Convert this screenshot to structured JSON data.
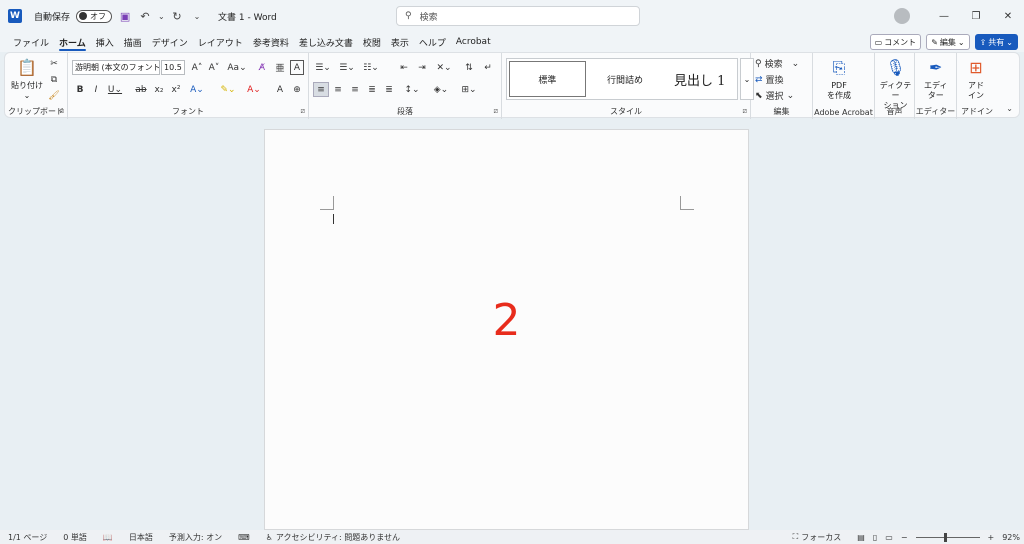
{
  "titlebar": {
    "autosave_label": "自動保存",
    "autosave_state": "オフ",
    "doc_title": "文書 1  -  Word",
    "search_placeholder": "検索"
  },
  "menu": {
    "tabs": [
      "ファイル",
      "ホーム",
      "挿入",
      "描画",
      "デザイン",
      "レイアウト",
      "参考資料",
      "差し込み文書",
      "校閲",
      "表示",
      "ヘルプ",
      "Acrobat"
    ],
    "active": "ホーム",
    "comment_label": "コメント",
    "edit_label": "編集",
    "share_label": "共有"
  },
  "ribbon": {
    "clipboard": {
      "paste_label": "貼り付け",
      "group_label": "クリップボード"
    },
    "font": {
      "font_name": "游明朝 (本文のフォント",
      "font_size": "10.5",
      "group_label": "フォント"
    },
    "paragraph": {
      "group_label": "段落"
    },
    "styles": {
      "items": [
        "標準",
        "行間詰め",
        "見出し 1"
      ],
      "group_label": "スタイル"
    },
    "editing": {
      "find_label": "検索",
      "replace_label": "置換",
      "select_label": "選択",
      "group_label": "編集"
    },
    "acrobat": {
      "pdf_label_1": "PDF",
      "pdf_label_2": "を作成",
      "group_label": "Adobe Acrobat"
    },
    "voice": {
      "dictation_label_1": "ディクテー",
      "dictation_label_2": "ション",
      "group_label": "音声"
    },
    "editor": {
      "editor_label_1": "エディ",
      "editor_label_2": "ター",
      "group_label": "エディター"
    },
    "addins": {
      "addin_label_1": "アド",
      "addin_label_2": "イン",
      "group_label": "アドイン"
    }
  },
  "document": {
    "body_text": "2",
    "body_text_color": "#e82c1c"
  },
  "statusbar": {
    "page": "1/1 ページ",
    "words": "0 単語",
    "language": "日本語",
    "ime": "予測入力: オン",
    "accessibility": "アクセシビリティ: 問題ありません",
    "focus": "フォーカス",
    "zoom": "92%",
    "zoom_fraction": 0.46
  },
  "colors": {
    "accent": "#185abd"
  }
}
